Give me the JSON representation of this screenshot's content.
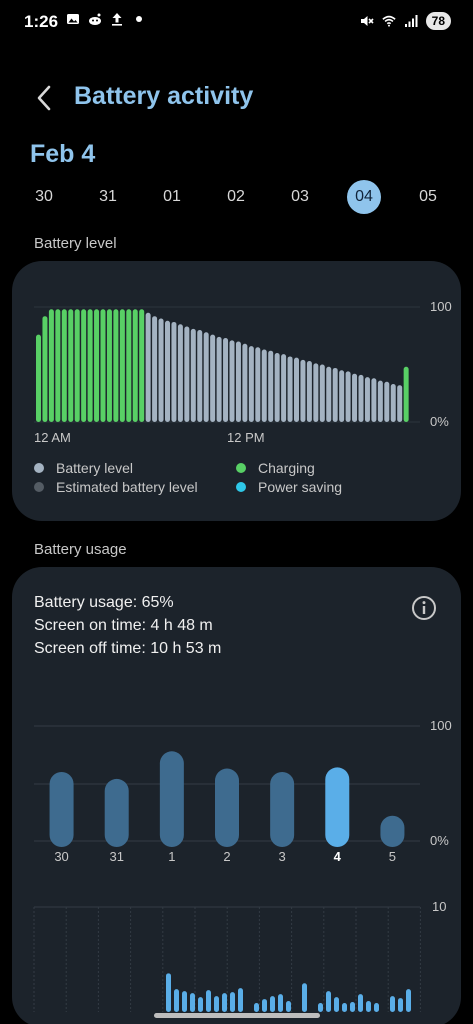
{
  "status_bar": {
    "time": "1:26",
    "left_icons": [
      "gallery-icon",
      "reddit-icon",
      "upload-icon",
      "dot-icon"
    ],
    "right_icons": [
      "mute-icon",
      "wifi-icon",
      "signal-icon"
    ],
    "battery": "78"
  },
  "header": {
    "title": "Battery activity"
  },
  "date_heading": "Feb 4",
  "days": [
    "30",
    "31",
    "01",
    "02",
    "03",
    "04",
    "05"
  ],
  "selected_day": "04",
  "battery_level": {
    "label": "Battery level",
    "legend": [
      {
        "label": "Battery level",
        "color": "#a4b3c2"
      },
      {
        "label": "Charging",
        "color": "#58d065"
      },
      {
        "label": "Estimated battery level",
        "color": "#545c64"
      },
      {
        "label": "Power saving",
        "color": "#2ec8e8"
      }
    ]
  },
  "battery_usage": {
    "label": "Battery usage",
    "usage_text": "Battery usage: 65%",
    "screen_on": "Screen on time: 4 h 48 m",
    "screen_off": "Screen off time: 10 h 53 m"
  },
  "colors": {
    "accent": "#8fc4ec",
    "card_bg": "#1c232b",
    "charging": "#58d065",
    "battery": "#a4b3c2",
    "usage_bar": "#3e6b8f",
    "usage_bar_selected": "#5aaee8"
  },
  "chart_data": [
    {
      "type": "bar",
      "x_labels": [
        "12 AM",
        "12 PM"
      ],
      "ylabels": [
        "100",
        "0%"
      ],
      "ylim": [
        0,
        100
      ],
      "series": [
        {
          "name": "Charging",
          "color": "#58d065",
          "values": [
            76,
            92,
            98,
            98,
            98,
            98,
            98,
            98,
            98,
            98,
            98,
            98,
            98,
            98,
            98,
            98,
            98
          ]
        },
        {
          "name": "Battery level",
          "color": "#a4b3c2",
          "values": [
            95,
            92,
            90,
            88,
            87,
            85,
            83,
            81,
            80,
            78,
            76,
            74,
            73,
            71,
            70,
            68,
            66,
            65,
            63,
            62,
            60,
            59,
            57,
            56,
            54,
            53,
            51,
            50,
            48,
            47,
            45,
            44,
            42,
            41,
            39,
            38,
            36,
            35,
            33,
            32
          ]
        },
        {
          "name": "Charging",
          "color": "#58d065",
          "values": [
            48
          ]
        }
      ]
    },
    {
      "type": "bar",
      "categories": [
        "30",
        "31",
        "1",
        "2",
        "3",
        "4",
        "5"
      ],
      "values": [
        60,
        54,
        78,
        63,
        60,
        64,
        22
      ],
      "selected_index": 5,
      "ylabels": [
        "100",
        "0%"
      ],
      "ylim": [
        0,
        100
      ]
    },
    {
      "type": "bar",
      "ylabels": [
        "10"
      ],
      "ylim": [
        0,
        10
      ],
      "values": [
        3.3,
        1.7,
        1.5,
        1.3,
        0.9,
        1.6,
        1.0,
        1.3,
        1.4,
        1.8,
        0.3,
        0.7,
        1.0,
        1.2,
        0.5,
        2.3,
        0.3,
        1.5,
        0.9,
        0.3,
        0.4,
        1.2,
        0.5,
        0.3,
        1.0,
        0.8,
        1.7
      ]
    }
  ]
}
